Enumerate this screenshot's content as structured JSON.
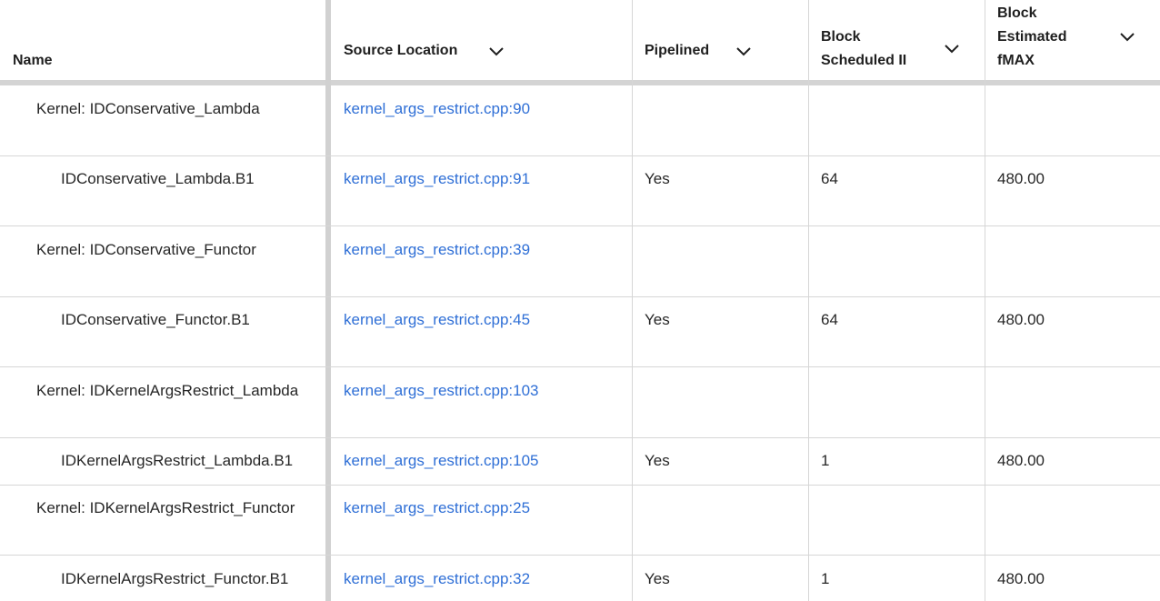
{
  "columns": {
    "name": "Name",
    "source": "Source Location",
    "pipelined": "Pipelined",
    "ii_line1": "Block",
    "ii_line2": "Scheduled II",
    "fmax_line1": "Block",
    "fmax_line2": "Estimated",
    "fmax_line3": "fMAX"
  },
  "rows": [
    {
      "name": "Kernel: IDConservative_Lambda",
      "source": "kernel_args_restrict.cpp:90",
      "pipelined": "",
      "ii": "",
      "fmax": ""
    },
    {
      "name": "IDConservative_Lambda.B1",
      "source": "kernel_args_restrict.cpp:91",
      "pipelined": "Yes",
      "ii": "64",
      "fmax": "480.00"
    },
    {
      "name": "Kernel: IDConservative_Functor",
      "source": "kernel_args_restrict.cpp:39",
      "pipelined": "",
      "ii": "",
      "fmax": ""
    },
    {
      "name": "IDConservative_Functor.B1",
      "source": "kernel_args_restrict.cpp:45",
      "pipelined": "Yes",
      "ii": "64",
      "fmax": "480.00"
    },
    {
      "name": "Kernel: IDKernelArgsRestrict_Lambda",
      "source": "kernel_args_restrict.cpp:103",
      "pipelined": "",
      "ii": "",
      "fmax": ""
    },
    {
      "name": "IDKernelArgsRestrict_Lambda.B1",
      "source": "kernel_args_restrict.cpp:105",
      "pipelined": "Yes",
      "ii": "1",
      "fmax": "480.00"
    },
    {
      "name": "Kernel: IDKernelArgsRestrict_Functor",
      "source": "kernel_args_restrict.cpp:25",
      "pipelined": "",
      "ii": "",
      "fmax": ""
    },
    {
      "name": "IDKernelArgsRestrict_Functor.B1",
      "source": "kernel_args_restrict.cpp:32",
      "pipelined": "Yes",
      "ii": "1",
      "fmax": "480.00"
    }
  ],
  "colors": {
    "link": "#2f6fd6",
    "divider": "#d6d6d6",
    "header_rule": "#d4d4d4"
  },
  "icons": {
    "sort": "chevron-down-icon"
  }
}
